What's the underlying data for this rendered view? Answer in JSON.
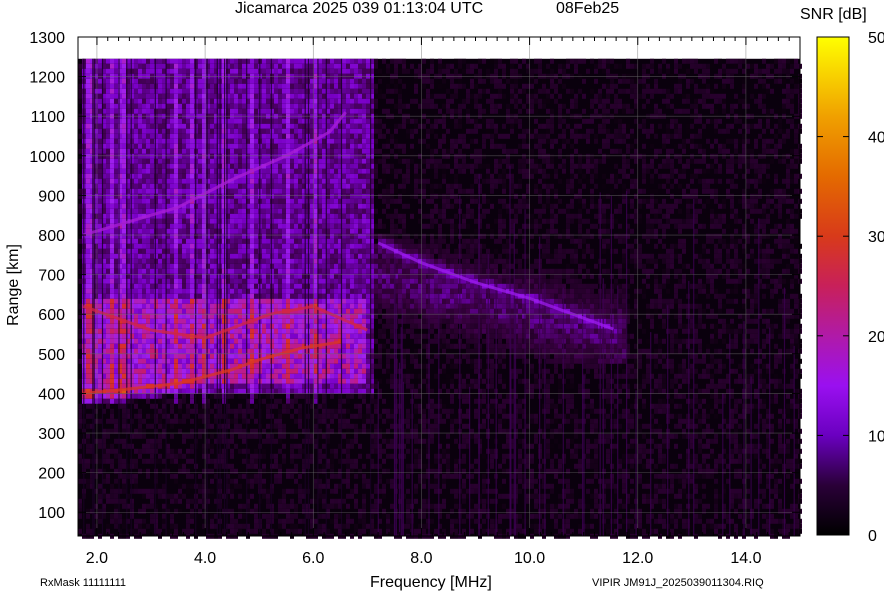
{
  "header": {
    "title": "Jicamarca 2025 039 01:13:04 UTC",
    "date": "08Feb25"
  },
  "footer": {
    "rxmask": "RxMask 11111111",
    "filename": "VIPIR  JM91J_2025039011304.RIQ"
  },
  "colors": {
    "background": "#ffffff",
    "plot_background": "#0a000d",
    "gridline": "#6e6e6e",
    "colormap": [
      "#000000",
      "#3a0042",
      "#7a00c8",
      "#a020f0",
      "#c21a7a",
      "#d82c2c",
      "#e05a10",
      "#f0a000",
      "#ffe000",
      "#ffff00"
    ]
  },
  "chart_data": {
    "type": "heatmap",
    "title": "Jicamarca 2025 039 01:13:04 UTC",
    "xlabel": "Frequency [MHz]",
    "ylabel": "Range [km]",
    "xlim": [
      1.65,
      15.0
    ],
    "ylim": [
      40,
      1300
    ],
    "data_range_max_km": 1245,
    "x_ticks": [
      2.0,
      4.0,
      6.0,
      8.0,
      10.0,
      12.0,
      14.0
    ],
    "x_tick_labels": [
      "2.0",
      "4.0",
      "6.0",
      "8.0",
      "10.0",
      "12.0",
      "14.0"
    ],
    "y_ticks": [
      100,
      200,
      300,
      400,
      500,
      600,
      700,
      800,
      900,
      1000,
      1100,
      1200,
      1300
    ],
    "y_tick_labels": [
      "100",
      "200",
      "300",
      "400",
      "500",
      "600",
      "700",
      "800",
      "900",
      "1000",
      "1100",
      "1200",
      "1300"
    ],
    "grid": true,
    "colorbar": {
      "title": "SNR [dB]",
      "range": [
        0,
        50
      ],
      "ticks": [
        0,
        10,
        20,
        30,
        40,
        50
      ],
      "tick_labels": [
        "0",
        "10",
        "20",
        "30",
        "40",
        "50"
      ]
    },
    "echo_traces": [
      {
        "name": "F-layer O-mode lower edge",
        "points": [
          [
            1.75,
            400
          ],
          [
            2.5,
            410
          ],
          [
            3.5,
            425
          ],
          [
            4.5,
            460
          ],
          [
            5.0,
            485
          ],
          [
            5.8,
            515
          ],
          [
            6.5,
            530
          ]
        ],
        "snr_db": 25
      },
      {
        "name": "F-layer second hop",
        "points": [
          [
            1.75,
            800
          ],
          [
            2.5,
            830
          ],
          [
            3.5,
            870
          ],
          [
            4.5,
            940
          ],
          [
            5.5,
            1000
          ],
          [
            6.3,
            1060
          ],
          [
            6.6,
            1110
          ]
        ],
        "snr_db": 14
      },
      {
        "name": "F-layer spread diffuse echo",
        "points": [
          [
            7.2,
            780
          ],
          [
            8.0,
            730
          ],
          [
            9.0,
            680
          ],
          [
            10.0,
            640
          ],
          [
            11.0,
            590
          ],
          [
            11.6,
            560
          ]
        ],
        "snr_db": 12
      },
      {
        "name": "F-layer main spread region",
        "points": [
          [
            1.75,
            620
          ],
          [
            3.0,
            560
          ],
          [
            4.0,
            540
          ],
          [
            5.2,
            600
          ],
          [
            6.0,
            620
          ],
          [
            7.0,
            560
          ]
        ],
        "snr_db": 22
      }
    ],
    "regions": [
      {
        "name": "low-frequency diffuse band",
        "x": [
          1.75,
          7.1
        ],
        "y": [
          400,
          1245
        ],
        "snr_db": 11
      },
      {
        "name": "strong spread band",
        "x": [
          1.75,
          7.0
        ],
        "y": [
          420,
          640
        ],
        "snr_db": 20
      },
      {
        "name": "mid-frequency diffuse band",
        "x": [
          7.1,
          11.8
        ],
        "y": [
          480,
          800
        ],
        "snr_db": 9
      }
    ]
  }
}
